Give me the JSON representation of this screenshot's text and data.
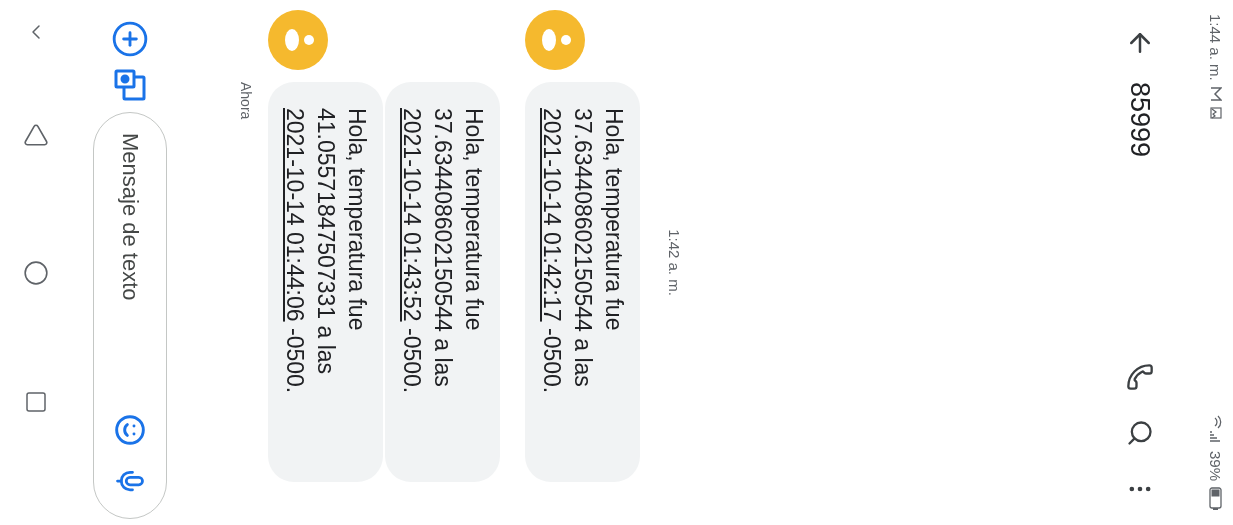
{
  "status_bar": {
    "time": "1:44 a. m.",
    "battery": "39%"
  },
  "app_bar": {
    "title": "85999"
  },
  "timestamp": "1:42 a. m.",
  "messages": [
    {
      "text": "Hola, temperatura fue 37.634408602150544 a las",
      "link": "2021-10-14 01:42:17",
      "tail": " -0500.",
      "avatar": true
    },
    {
      "text": "Hola, temperatura fue 37.634408602150544 a las",
      "link": "2021-10-14 01:43:52",
      "tail": " -0500.",
      "avatar": false
    },
    {
      "text": "Hola, temperatura fue 41.05571847507331 a las",
      "link": "2021-10-14 01:44:06",
      "tail": " -0500.",
      "avatar": true
    }
  ],
  "status_note": "Ahora",
  "composer": {
    "placeholder": "Mensaje de texto"
  }
}
